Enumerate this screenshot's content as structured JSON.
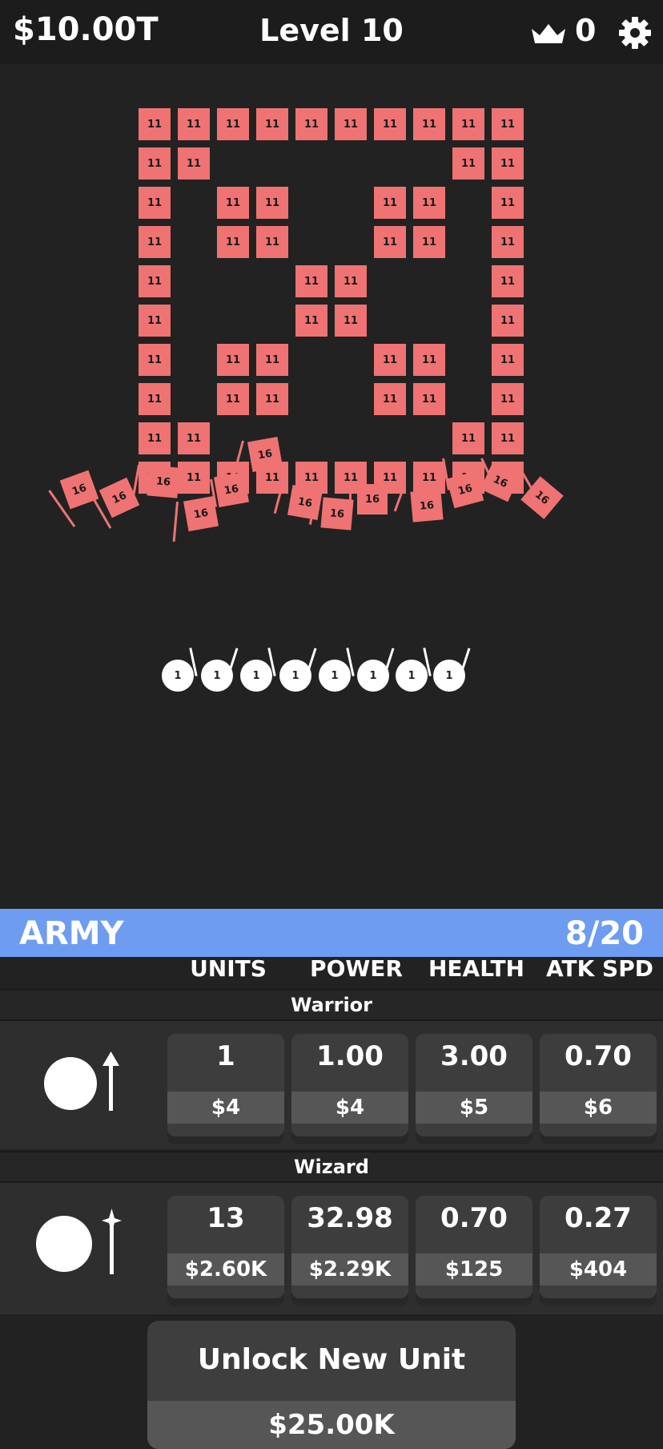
{
  "header": {
    "money": "$10.00T",
    "level": "Level 10",
    "crowns": "0"
  },
  "arena": {
    "wall_brick_value": "11",
    "falling_brick_value": "16",
    "unit_ball_value": "1",
    "brick_color": "#ef7373"
  },
  "army": {
    "title": "ARMY",
    "count": "8/20",
    "columns": [
      "UNITS",
      "POWER",
      "HEALTH",
      "ATK SPD"
    ],
    "units": [
      {
        "name": "Warrior",
        "stats": [
          {
            "value": "1",
            "cost": "$4"
          },
          {
            "value": "1.00",
            "cost": "$4"
          },
          {
            "value": "3.00",
            "cost": "$5"
          },
          {
            "value": "0.70",
            "cost": "$6"
          }
        ]
      },
      {
        "name": "Wizard",
        "stats": [
          {
            "value": "13",
            "cost": "$2.60K"
          },
          {
            "value": "32.98",
            "cost": "$2.29K"
          },
          {
            "value": "0.70",
            "cost": "$125"
          },
          {
            "value": "0.27",
            "cost": "$404"
          }
        ]
      }
    ],
    "unlock": {
      "label": "Unlock New Unit",
      "price": "$25.00K"
    }
  },
  "colors": {
    "accent": "#6e9cf0",
    "brick": "#ef7373",
    "background": "#222222"
  }
}
